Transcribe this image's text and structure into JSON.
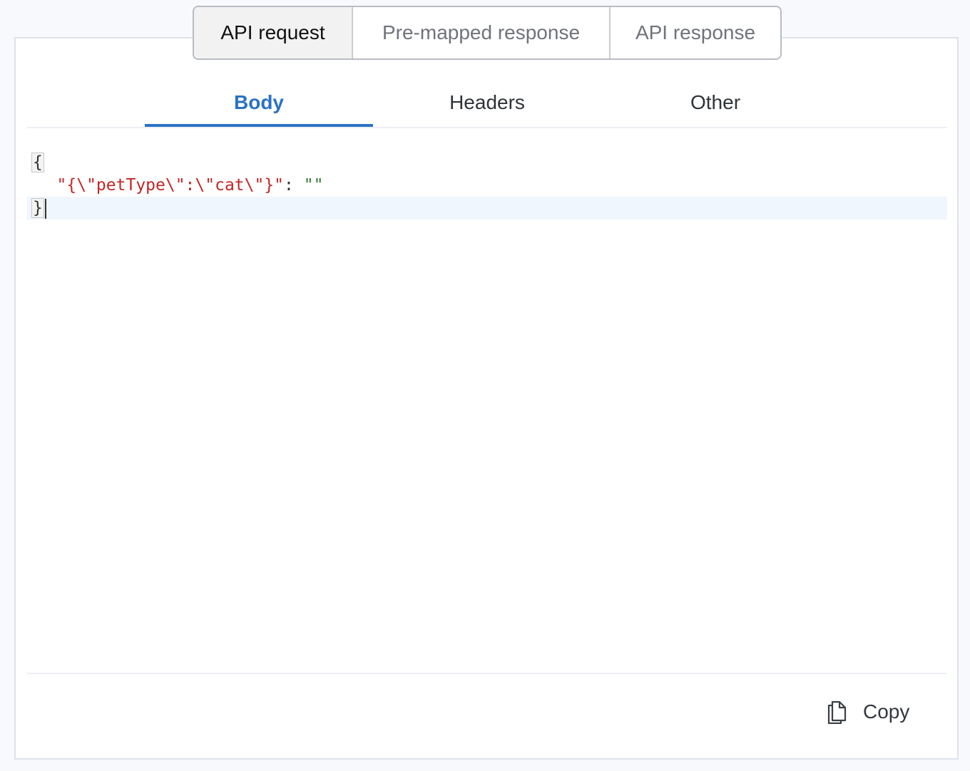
{
  "segmented_tabs": [
    {
      "label": "API request",
      "active": true
    },
    {
      "label": "Pre-mapped response",
      "active": false
    },
    {
      "label": "API response",
      "active": false
    }
  ],
  "sub_tabs": [
    {
      "label": "Body",
      "active": true
    },
    {
      "label": "Headers",
      "active": false
    },
    {
      "label": "Other",
      "active": false
    }
  ],
  "editor": {
    "open_brace": "{",
    "key": "\"{\\\"petType\\\":\\\"cat\\\"}\"",
    "colon": ": ",
    "value": "\"\"",
    "close_brace": "}"
  },
  "footer": {
    "copy_label": "Copy",
    "copy_icon": "copy-icon"
  },
  "colors": {
    "accent": "#2a72c4",
    "json_key": "#c22727",
    "json_string": "#2f7d32",
    "current_line": "#eff6fd"
  }
}
